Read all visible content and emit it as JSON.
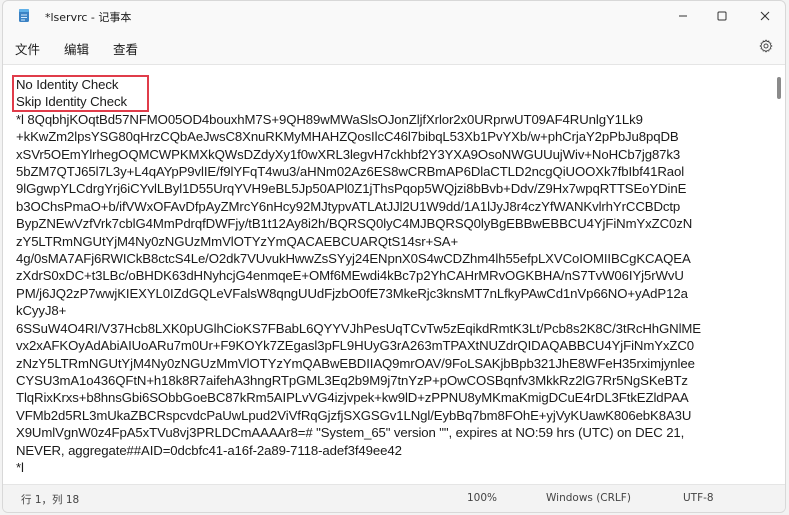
{
  "window": {
    "title": "*lservrc - 记事本",
    "controls": {
      "minimize": "minimize",
      "maximize": "maximize",
      "close": "close"
    }
  },
  "menu": {
    "items": [
      "文件",
      "编辑",
      "查看"
    ]
  },
  "editor": {
    "highlight_color": "#e03c4a",
    "lines": [
      "No Identity Check",
      "Skip Identity Check",
      "*l 8QqbhjKOqtBd57NFMO05OD4bouxhM7S+9QH89wMWaSlsOJonZljfXrlor2x0URprwUT09AF4RUnlgY1Lk9",
      "+kKwZm2lpsYSG80qHrzCQbAeJwsC8XnuRKMyMHAHZQosIlcC46l7bibqL53Xb1PvYXb/w+phCrjaY2pPbJu8pqDB",
      "xSVr5OEmYlrhegOQMCWPKMXkQWsDZdyXy1f0wXRL3legvH7ckhbf2Y3YXA9OsoNWGUUujWiv+NoHCb7jg87k3",
      "5bZM7QTJ65l7L3y+L4qAYpP9vlIE/f9lYFqT4wu3/aHNm02Az6ES8wCRBmAP6DlaCTLD2ncgQiUOOXk7fbIbf41Raol",
      "9lGgwpYLCdrgYrj6iCYvlLByl1D55UrqYVH9eBL5Jp50APl0Z1jThsPqop5WQjzi8bBvb+Ddv/Z9Hx7wpqRTTSEoYDinE",
      "b3OChsPmaO+b/ifVWxOFAvDfpAyZMrcY6nHcy92MJtypvATLAtJJl2U1W9dd/1A1lJyJ8r4czYfWANKvlrhYrCCBDctp",
      "BypZNEwVzfVrk7cblG4MmPdrqfDWFjy/tB1t12Ay8i2h/BQRSQ0lyC4MJBQRSQ0lyBgEBBwEBBCU4YjFiNmYxZC0zN",
      "zY5LTRmNGUtYjM4Ny0zNGUzMmVlOTYzYmQACAEBCUARQtS14sr+SA+",
      "4g/0sMA7AFj6RWICkB8ctcS4Le/O2dk7VUvukHwwZsSYyj24ENpnX0S4wCDZhm4lh55efpLXVCoIOMIIBCgKCAQEA",
      "zXdrS0xDC+t3LBc/oBHDK63dHNyhcjG4enmqeE+OMf6MEwdi4kBc7p2YhCAHrMRvOGKBHA/nS7TvW06IYj5rWvU",
      "PM/j6JQ2zP7wwjKIEXYL0IZdGQLeVFalsW8qngUUdFjzbO0fE73MkeRjc3knsMT7nLfkyPAwCd1nVp66NO+yAdP12a",
      "kCyyJ8+",
      "6SSuW4O4RI/V37Hcb8LXK0pUGlhCioKS7FBabL6QYYVJhPesUqTCvTw5zEqikdRmtK3Lt/Pcb8s2K8C/3tRcHhGNlME",
      "vx2xAFKOyAdAbiAIUoARu7m0Ur+F9KOYk7ZEgasl3pFL9HUyG3rA263mTPAXtNUZdrQIDAQABBCU4YjFiNmYxZC0",
      "zNzY5LTRmNGUtYjM4Ny0zNGUzMmVlOTYzYmQABwEBDIIAQ9mrOAV/9FoLSAKjbBpb321JhE8WFeH35rximjynlee",
      "CYSU3mA1o436QFtN+h18k8R7aifehA3hngRTpGML3Eq2b9M9j7tnYzP+pOwCOSBqnfv3MkkRz2lG7Rr5NgSKeBTz",
      "TlqRixKrxs+b8hnsGbi6SObbGoeBC87kRm5AIPLvVG4izjvpek+kw9lD+zPPNU8yMKmaKmigDCuE4rDL3FtkEZldPAA",
      "VFMb2d5RL3mUkaZBCRspcvdcPaUwLpud2ViVfRqGjzfjSXGSGv1LNgl/EybBq7bm8FOhE+yjVyKUawK806ebK8A3U",
      "X9UmlVgnW0z4FpA5xTVu8vj3PRLDCmAAAAr8=# \"System_65\" version \"\", expires at NO:59 hrs (UTC) on DEC 21,",
      "NEVER, aggregate##AID=0dcbfc41-a16f-2a89-7118-adef3f49ee42",
      "*l"
    ]
  },
  "status": {
    "position": "行 1，列 18",
    "zoom": "100%",
    "line_ending": "Windows (CRLF)",
    "encoding": "UTF-8"
  }
}
